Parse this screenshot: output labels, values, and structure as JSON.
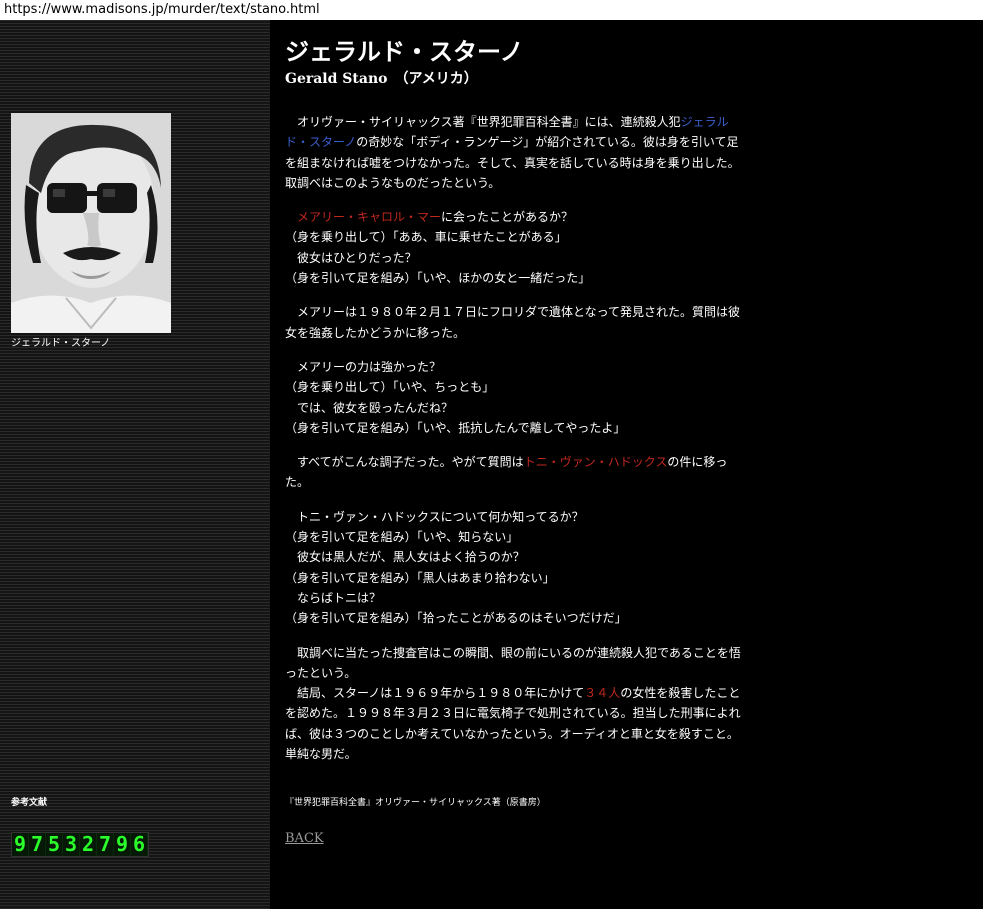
{
  "browser": {
    "url": "https://www.madisons.jp/murder/text/stano.html"
  },
  "sidebar": {
    "photo_caption": "ジェラルド・スターノ",
    "refs_label": "参考文献",
    "counter_digits": [
      "9",
      "7",
      "5",
      "3",
      "2",
      "7",
      "9",
      "6"
    ]
  },
  "main": {
    "title": "ジェラルド・スターノ",
    "subtitle": "Gerald Stano　（アメリカ）",
    "p1": {
      "pre": "　オリヴァー・サイリャックス著『世界犯罪百科全書』には、連続殺人犯",
      "link": "ジェラルド・スターノ",
      "post": "の奇妙な「ボディ・ランゲージ」が紹介されている。彼は身を引いて足を組まなければ嘘をつけなかった。そして、真実を話している時は身を乗り出した。取調べはこのようなものだった",
      "tail": "という。"
    },
    "p2": {
      "name": "　メアリー・キャロル・マー",
      "line1_rest": "に会ったことがあるか？",
      "line2": "（身を乗り出して）「ああ、車に乗せたことがある」",
      "line3": "　彼女はひとりだった？",
      "line4": "（身を引いて足を組み）「いや、ほかの女と一緒だった」"
    },
    "p3": "　メアリーは１９８０年２月１７日にフロリダで遺体となって発見された。質問は彼女を強姦したかどうかに移った。",
    "p4": {
      "line1": "　メアリーの力は強かった？",
      "line2": "（身を乗り出して）「いや、ちっとも」",
      "line3": "　では、彼女を殴ったんだね？",
      "line4": "（身を引いて足を組み）「いや、抵抗したんで離してやったよ」"
    },
    "p5": {
      "pre": "　すべてがこんな調子だった。やがて質問は",
      "name": "トニ・ヴァン・ハドックス",
      "post": "の件に移った。"
    },
    "p6": {
      "line1": "　トニ・ヴァン・ハドックスについて何か知ってるか？",
      "line2": "（身を引いて足を組み）「いや、知らない」",
      "line3": "　彼女は黒人だが、黒人女はよく拾うのか？",
      "line4": "（身を引いて足を組み）「黒人はあまり拾わない」",
      "line5": "　ならばトニは？",
      "line6": "（身を引いて足を組み）「拾ったことがあるのはそいつだけだ」"
    },
    "p7": {
      "line1": "　取調べに当たった捜査官はこの瞬間、眼の前にいるのが連続殺人犯であることを悟ったという。",
      "pre": "　結局、スターノは１９６９年から１９８０年にかけて",
      "count": "３４人",
      "post": "の女性を殺害したことを認めた。１９９８年３月２３日に電気椅子で処刑されている。担当した刑事によれば、彼は３つのことしか考えていなかったという。オーディオと車と女を殺すこと。単純な男だ。"
    },
    "reference": "『世界犯罪百科全書』オリヴァー・サイリャックス著（原書房）",
    "back_label": "BACK"
  },
  "colors": {
    "link_red": "#c0281e",
    "link_blue": "#3a5ecc",
    "counter_green": "#2bff2b"
  }
}
